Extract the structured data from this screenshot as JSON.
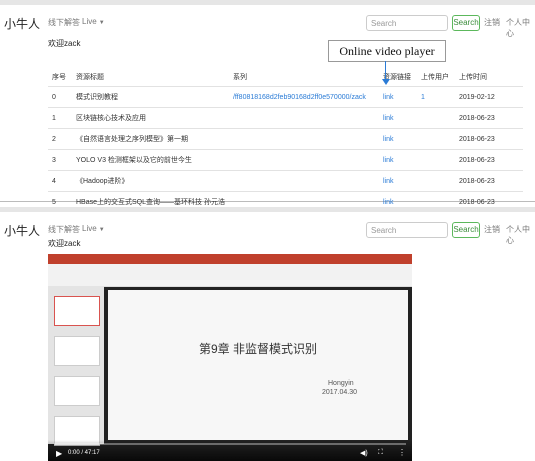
{
  "nav": {
    "brand": "小牛人",
    "qa": "线下解答",
    "live": "Live",
    "search_placeholder": "Search",
    "search_button": "Search",
    "logout": "注销",
    "profile": "个人中心"
  },
  "welcome": "欢迎zack",
  "callout": "Online video player",
  "table": {
    "headers": [
      "序号",
      "资源标题",
      "系列",
      "资源链接",
      "上传用户",
      "上传时间"
    ],
    "rows": [
      {
        "idx": "0",
        "title": "模式识别教程",
        "series": "/ff80818168d2feb90168d2ff0e570000/zack",
        "link": "link",
        "user": "1",
        "date": "2019-02-12"
      },
      {
        "idx": "1",
        "title": "区块链核心技术及应用",
        "series": "",
        "link": "link",
        "user": "",
        "date": "2018-06-23"
      },
      {
        "idx": "2",
        "title": "《自然语言处理之序列模型》第一期",
        "series": "",
        "link": "link",
        "user": "",
        "date": "2018-06-23"
      },
      {
        "idx": "3",
        "title": "YOLO V3 检测框架以及它的前世今生",
        "series": "",
        "link": "link",
        "user": "",
        "date": "2018-06-23"
      },
      {
        "idx": "4",
        "title": "《Hadoop进阶》",
        "series": "",
        "link": "link",
        "user": "",
        "date": "2018-06-23"
      },
      {
        "idx": "5",
        "title": "HBase上的交互式SQL查询——基环科技 孙元浩",
        "series": "",
        "link": "link",
        "user": "",
        "date": "2018-06-23"
      }
    ]
  },
  "player": {
    "slide_title": "第9章 非监督模式识别",
    "author": "Hongyin",
    "date": "2017.04.30",
    "time": "0:00 / 47:17"
  }
}
